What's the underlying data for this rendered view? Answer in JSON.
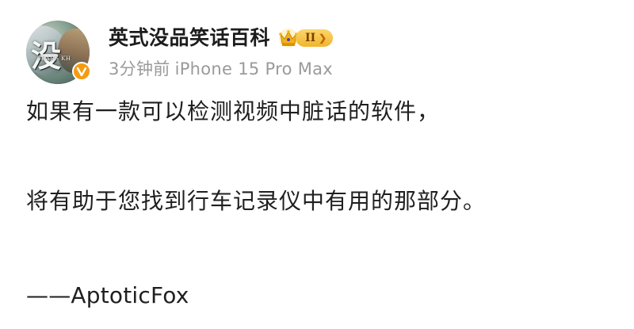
{
  "author": {
    "name": "英式没品笑话百科",
    "avatar_glyph": "没",
    "avatar_caption": "TEARS KH",
    "verified_icon": "verified-v-icon",
    "member_badge": {
      "icon": "crown-icon",
      "level": "II",
      "arrow": "❯"
    }
  },
  "post_meta": {
    "time": "3分钟前",
    "device": "iPhone 15 Pro Max"
  },
  "post": {
    "paragraphs": [
      "如果有一款可以检测视频中脏话的软件，",
      "将有助于您找到行车记录仪中有用的那部分。",
      "——AptoticFox"
    ]
  },
  "colors": {
    "name": "#1c1c1c",
    "meta": "#9a9a9a",
    "body": "#1f1f1f",
    "badge_gold": "#f1b52f",
    "verified_orange": "#f39c12"
  }
}
